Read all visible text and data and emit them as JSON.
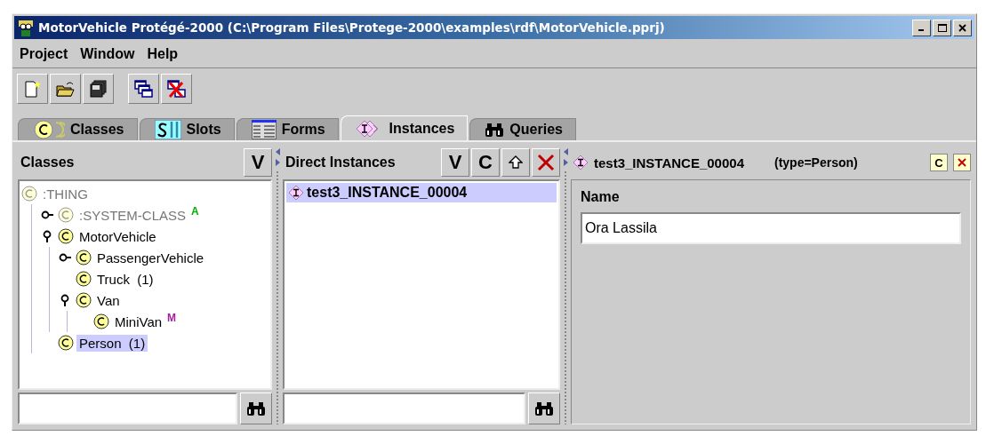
{
  "window": {
    "title": "MotorVehicle  Protégé-2000    (C:\\Program Files\\Protege-2000\\examples\\rdf\\MotorVehicle.pprj)"
  },
  "menu": [
    {
      "label": "Project"
    },
    {
      "label": "Window"
    },
    {
      "label": "Help"
    }
  ],
  "tabs": [
    {
      "label": "Classes",
      "kind": "classes",
      "selected": false
    },
    {
      "label": "Slots",
      "kind": "slots",
      "selected": false
    },
    {
      "label": "Forms",
      "kind": "forms",
      "selected": false
    },
    {
      "label": "Instances",
      "kind": "instances",
      "selected": true
    },
    {
      "label": "Queries",
      "kind": "queries",
      "selected": false
    }
  ],
  "classes_panel": {
    "title": "Classes",
    "buttons": [
      "V"
    ],
    "tree": [
      {
        "label": ":THING",
        "disabled": true,
        "selected": false,
        "children": [
          {
            "label": ":SYSTEM-CLASS",
            "expanded": false,
            "disabled": true,
            "selected": false,
            "badge": "A",
            "color": "#00b000"
          },
          {
            "label": "MotorVehicle",
            "expanded": true,
            "disabled": false,
            "selected": false,
            "children": [
              {
                "label": "PassengerVehicle",
                "expanded": false,
                "disabled": false,
                "selected": false
              },
              {
                "label": "Truck",
                "disabled": false,
                "selected": false,
                "count": "(1)"
              },
              {
                "label": "Van",
                "expanded": true,
                "disabled": false,
                "selected": false,
                "children": [
                  {
                    "label": "MiniVan",
                    "disabled": false,
                    "selected": false,
                    "badge": "M",
                    "color": "#a020a0"
                  }
                ]
              }
            ]
          },
          {
            "label": "Person",
            "disabled": false,
            "selected": true,
            "count": "(1)"
          }
        ]
      }
    ]
  },
  "instances_panel": {
    "title": "Direct Instances",
    "buttons": [
      "V",
      "C"
    ],
    "items": [
      {
        "label": "test3_INSTANCE_00004",
        "selected": true
      }
    ]
  },
  "form_panel": {
    "instance": "test3_INSTANCE_00004",
    "type": "(type=Person)",
    "buttons": [
      "C"
    ],
    "fields": [
      {
        "label": "Name",
        "value": "Ora Lassila"
      }
    ]
  }
}
